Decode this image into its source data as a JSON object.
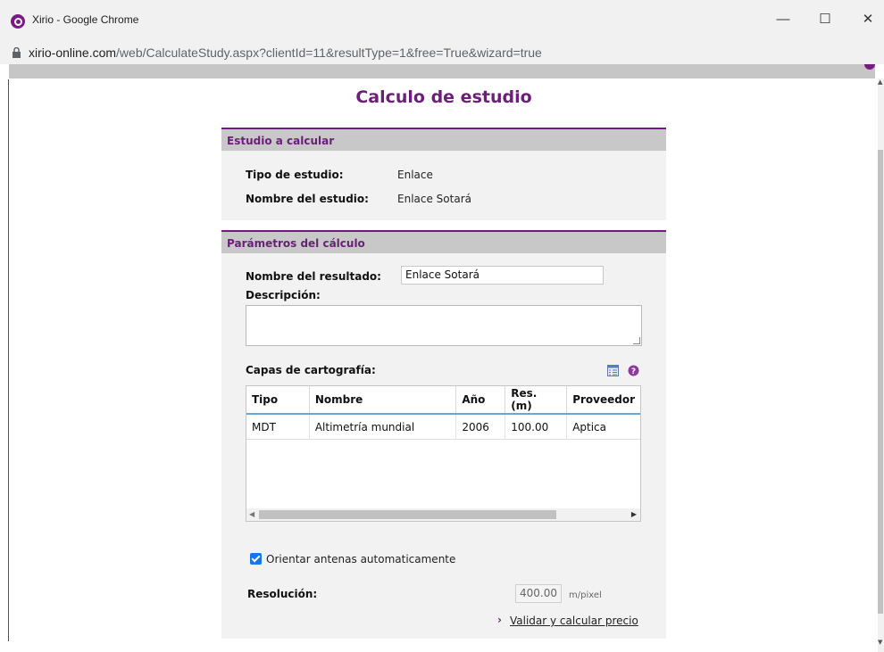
{
  "browser": {
    "window_title": "Xirio - Google Chrome",
    "url_host": "xirio-online.com",
    "url_path": "/web/CalculateStudy.aspx?clientId=11&resultType=1&free=True&wizard=true",
    "minimize": "—",
    "maximize": "☐",
    "close": "✕"
  },
  "page": {
    "heading": "Calculo de estudio",
    "study_section": {
      "title": "Estudio a calcular",
      "type_label": "Tipo de estudio:",
      "type_value": "Enlace",
      "name_label": "Nombre del estudio:",
      "name_value": "Enlace Sotará"
    },
    "params_section": {
      "title": "Parámetros del cálculo",
      "result_name_label": "Nombre del resultado:",
      "result_name_value": "Enlace Sotará",
      "description_label": "Descripción:",
      "description_value": "",
      "layers_label": "Capas de cartografía:",
      "table": {
        "columns": [
          "Tipo",
          "Nombre",
          "Año",
          "Res. (m)",
          "Proveedor"
        ],
        "rows": [
          [
            "MDT",
            "Altimetría mundial",
            "2006",
            "100.00",
            "Aptica"
          ]
        ]
      },
      "auto_orient_label": "Orientar antenas automaticamente",
      "auto_orient_checked": true,
      "resolution_label": "Resolución:",
      "resolution_value": "400.00",
      "resolution_unit": "m/pixel",
      "validate_link": "Validar y calcular precio"
    }
  },
  "colors": {
    "accent": "#6b1f78",
    "header_gray": "#c8c8c8",
    "panel_bg": "#f2f2f2",
    "checkbox_blue": "#1a73e8"
  }
}
